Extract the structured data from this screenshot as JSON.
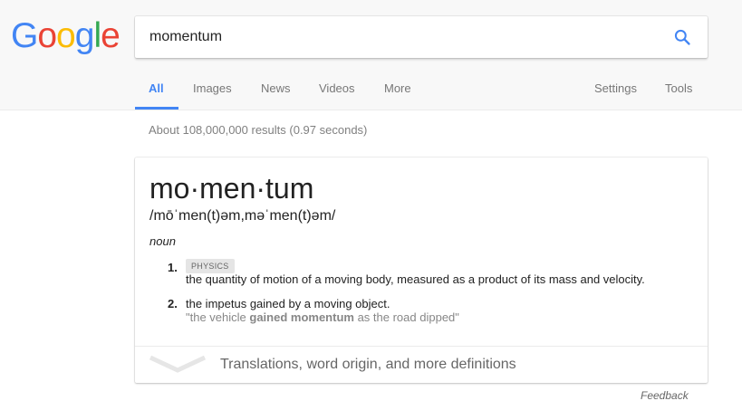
{
  "logo": {
    "letters": [
      "G",
      "o",
      "o",
      "g",
      "l",
      "e"
    ]
  },
  "search": {
    "query": "momentum"
  },
  "tabs": [
    {
      "label": "All",
      "active": true
    },
    {
      "label": "Images"
    },
    {
      "label": "News"
    },
    {
      "label": "Videos"
    },
    {
      "label": "More"
    },
    {
      "label": "Settings"
    },
    {
      "label": "Tools"
    }
  ],
  "result_stats": "About 108,000,000 results (0.97 seconds)",
  "dictionary": {
    "word": "mo·men·tum",
    "phonetic": "/mōˈmen(t)əm,məˈmen(t)əm/",
    "part_of_speech": "noun",
    "definitions": [
      {
        "number": "1.",
        "tag": "PHYSICS",
        "text": "the quantity of motion of a moving body, measured as a product of its mass and velocity."
      },
      {
        "number": "2.",
        "text": "the impetus gained by a moving object.",
        "example_before": "\"the vehicle ",
        "example_bold": "gained momentum",
        "example_after": " as the road dipped\""
      }
    ],
    "more_label": "Translations, word origin, and more definitions"
  },
  "feedback": "Feedback",
  "colors": {
    "accent": "#4285f4",
    "logo_blue": "#4285f4",
    "logo_red": "#ea4335",
    "logo_yellow": "#fbbc05",
    "logo_green": "#34a853"
  },
  "icons": {
    "search": "search-icon",
    "expand": "chevron-down-icon"
  }
}
